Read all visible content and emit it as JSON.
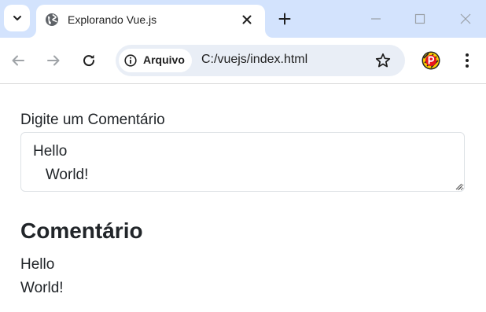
{
  "browser": {
    "tab": {
      "title": "Explorando Vue.js",
      "favicon": "globe-icon"
    },
    "toolbar": {
      "site_chip_label": "Arquivo",
      "site_chip_icon": "info-icon",
      "url": "C:/vuejs/index.html"
    },
    "icons": {
      "tab_search": "chevron-down-icon",
      "tab_close": "close-icon",
      "new_tab": "plus-icon",
      "minimize": "minimize-icon",
      "maximize": "maximize-icon",
      "close_window": "close-icon",
      "back": "arrow-left-icon",
      "forward": "arrow-right-icon",
      "reload": "reload-icon",
      "bookmark": "star-icon",
      "extension": "extension-icon",
      "menu": "kebab-menu-icon"
    },
    "colors": {
      "tabstrip": "#d3e3fd",
      "omnibox": "#e9eef6",
      "extension_red": "#e8141c",
      "extension_yellow": "#ffcc00"
    }
  },
  "page": {
    "field_label": "Digite um Comentário",
    "comment_value": "Hello\n   World!",
    "section_title": "Comentário",
    "output_text": "Hello\nWorld!"
  }
}
